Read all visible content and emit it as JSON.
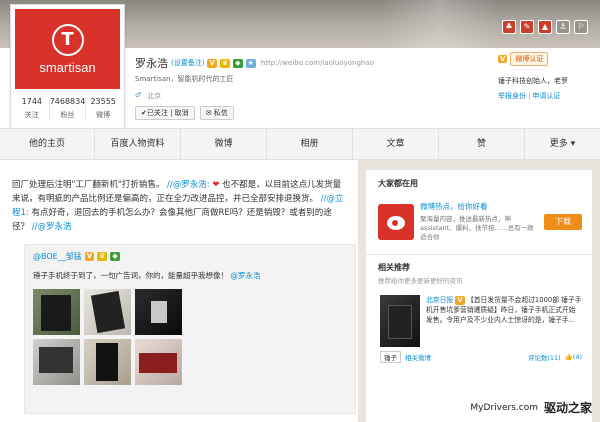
{
  "profile": {
    "name": "罗永浩",
    "remark_link": "(设置备注)",
    "homepage": "http://weibo.com/laoluoyonghao",
    "bio": "Smartisan，智能机时代的工匠",
    "gender_symbol": "♂",
    "location": "北京",
    "avatar_glyph": "T",
    "avatar_word": "smartisan",
    "follow_button": "✔已关注 | 取消",
    "message_button": "✉ 私信",
    "counts": [
      {
        "num": "1744",
        "label": "关注"
      },
      {
        "num": "7468834",
        "label": "粉丝"
      },
      {
        "num": "23555",
        "label": "微博"
      }
    ]
  },
  "verify": {
    "badge": "V",
    "label": "微博认证",
    "info": "锤子科技创始人，老罗",
    "report": "举报身份",
    "apply": "申请认证",
    "separator": "|"
  },
  "nav": {
    "items": [
      "他的主页",
      "百度人物资料",
      "微博",
      "相册",
      "文章",
      "赞",
      "更多 ▾"
    ]
  },
  "feed": {
    "text_before": "回厂处理后注明\"工厂翻新机\"打折销售。",
    "mention1": "//@罗永浩:",
    "text_mid": "也不都是，以目前这点儿发货量来说，有明疵的产品比例还是偏高的，正在全力改进品控，并已全部安排退换货。",
    "mention2": "//@立程1:",
    "text_after": "有点好奇，退回去的手机怎么办？会像其他厂商做RE吗？还是销毁？或者别的途径？",
    "mention3": "//@罗永浩",
    "repost": {
      "author": "@BOE__邹猛",
      "text": "锤子手机终于到了，一句广告词，你的，能量超乎我想像！",
      "mention": "@罗永浩"
    }
  },
  "sidebar": {
    "heading": "大家都在用",
    "app_title": "微博热点，给你好看",
    "app_desc": "聚海量内容，推送最新热点，神assistant、爆料、扶节按……总有一款适合你",
    "download": "下载",
    "rec_heading": "相关推荐",
    "rec_sub": "推荐给你更多更新更好的资讯",
    "rec_source": "北京日报",
    "rec_text": "【首日发货量不会超过1000部 锤子手机开售坑爹营销遭质疑】昨日，锤子手机正式开始发售。令用户及不少业内人士惊讶的是，锤子手...",
    "rec_tag": "锤子",
    "rec_tag_link": "相关微博",
    "rec_comments": "评论数(11)",
    "rec_likes": "(4)"
  },
  "watermark": {
    "site": "MyDrivers.com",
    "name": "驱动之家"
  },
  "cover_icons": [
    "♣",
    "✎",
    "▲",
    "⚓",
    "⚐"
  ]
}
